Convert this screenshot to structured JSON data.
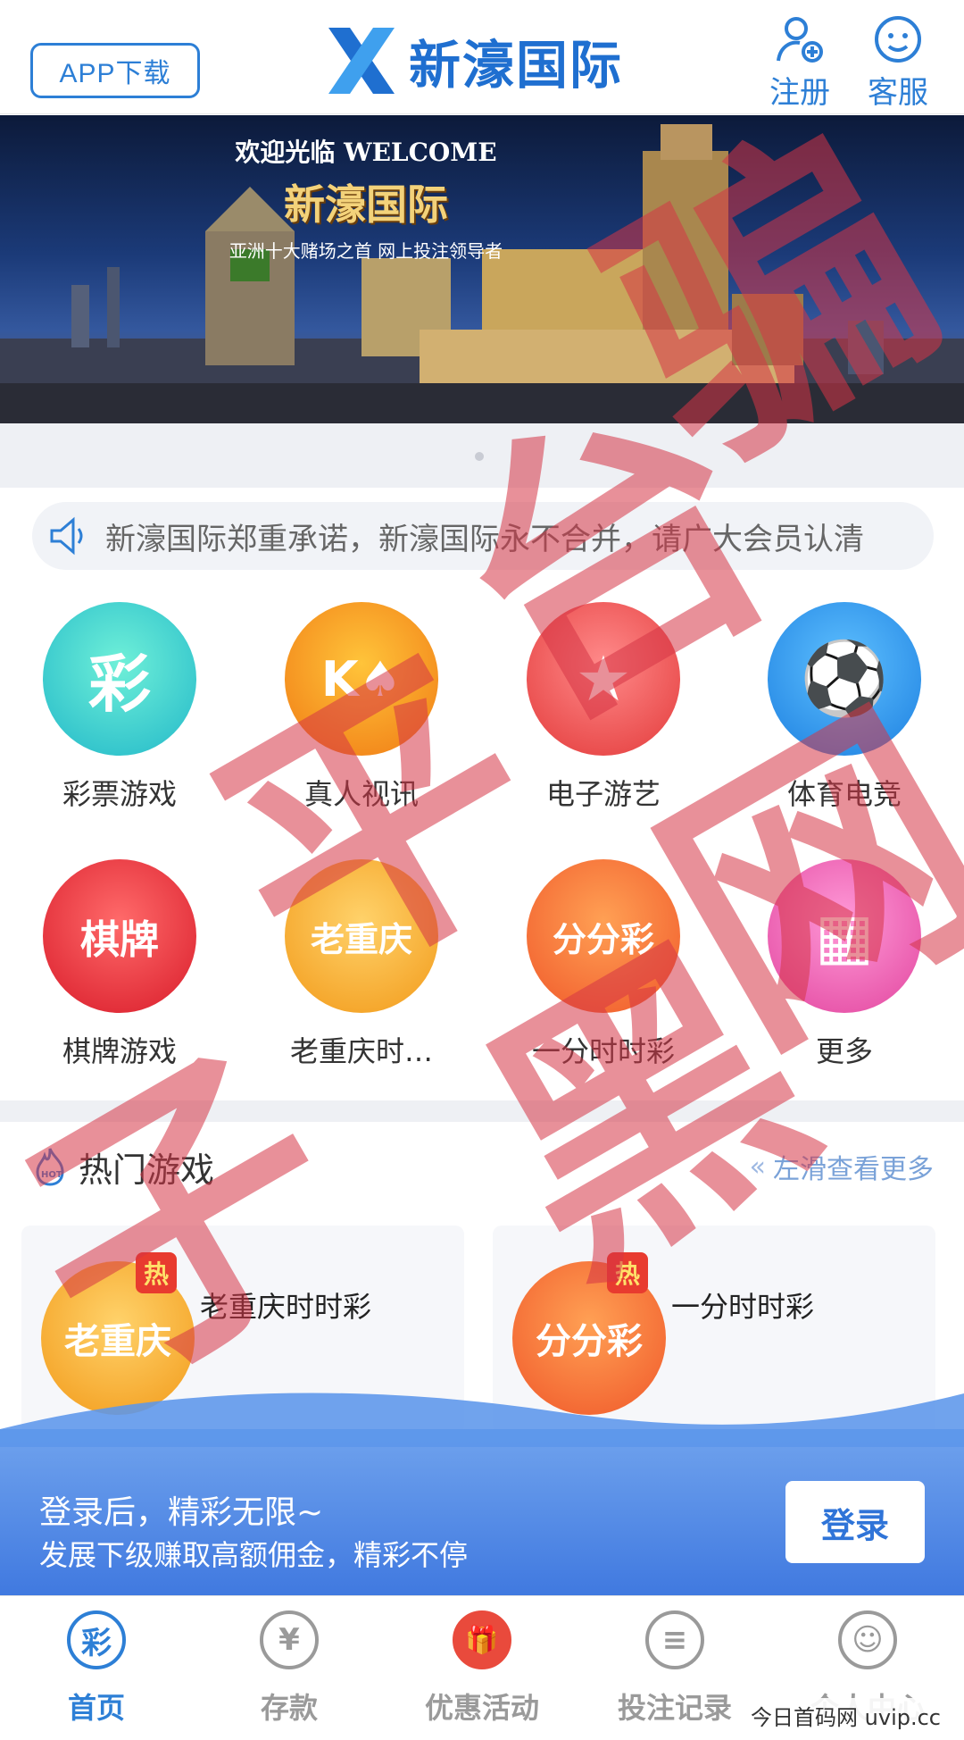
{
  "header": {
    "app_download": "APP下载",
    "logo_text": "新濠国际",
    "register": "注册",
    "service": "客服"
  },
  "banner": {
    "welcome": "欢迎光临 WELCOME",
    "brand": "新濠国际",
    "tagline": "亚洲十大赌场之首 网上投注领导者"
  },
  "notice": {
    "text": "新濠国际郑重承诺，新濠国际永不合并，请广大会员认清"
  },
  "games": [
    {
      "label": "彩票游戏",
      "glyph": "彩"
    },
    {
      "label": "真人视讯",
      "glyph": "K♠"
    },
    {
      "label": "电子游艺",
      "glyph": "★"
    },
    {
      "label": "体育电竞",
      "glyph": "⚽"
    },
    {
      "label": "棋牌游戏",
      "glyph": "棋牌"
    },
    {
      "label": "老重庆时…",
      "glyph": "老重庆"
    },
    {
      "label": "一分时时彩",
      "glyph": "分分彩"
    },
    {
      "label": "更多",
      "glyph": "▦"
    }
  ],
  "hot": {
    "title": "热门游戏",
    "more": "左滑查看更多",
    "badge": "热",
    "cards": [
      {
        "name": "老重庆时时彩",
        "glyph": "老重庆"
      },
      {
        "name": "一分时时彩",
        "glyph": "分分彩"
      }
    ]
  },
  "login_bar": {
    "line1": "登录后，精彩无限~",
    "line2": "发展下级赚取高额佣金，精彩不停",
    "button": "登录"
  },
  "tabs": [
    {
      "label": "首页",
      "glyph": "彩"
    },
    {
      "label": "存款",
      "glyph": "¥"
    },
    {
      "label": "优惠活动",
      "glyph": "🎁"
    },
    {
      "label": "投注记录",
      "glyph": "≡"
    },
    {
      "label": "个人中心",
      "glyph": "☺"
    }
  ],
  "watermark": {
    "stamp": [
      "骗",
      "子",
      "平",
      "台",
      "黑",
      "网"
    ],
    "footer": "今日首码网 uvip.cc"
  },
  "colors": {
    "brand_blue": "#2d7fd6",
    "login_blue": "#3672de",
    "stamp_red": "#d63446"
  }
}
